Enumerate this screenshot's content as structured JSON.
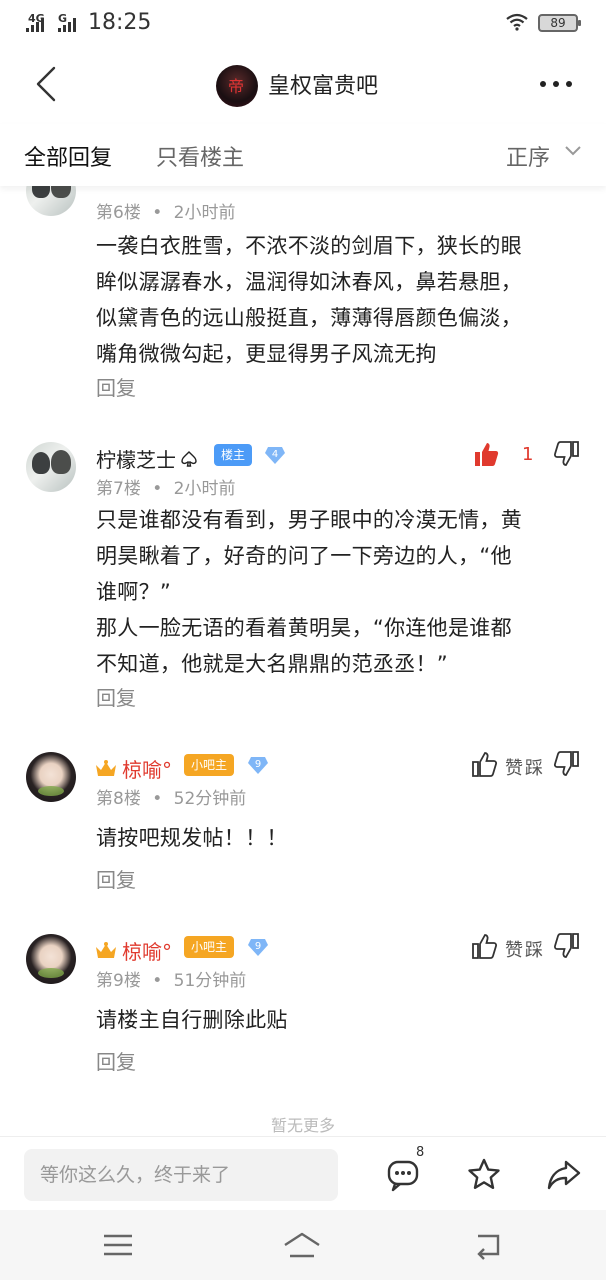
{
  "status_bar": {
    "signal1": "4G",
    "signal2": "G",
    "time": "18:25",
    "battery": "89"
  },
  "header": {
    "title": "皇权富贵吧"
  },
  "tabs": {
    "all": "全部回复",
    "owner_only": "只看楼主",
    "sort": "正序"
  },
  "posts": [
    {
      "floor": "第6楼",
      "time": "2小时前",
      "text_lines": [
        "一袭白衣胜雪，不浓不淡的剑眉下，狭长的眼",
        "眸似潺潺春水，温润得如沐春风，鼻若悬胆，",
        "似黛青色的远山般挺直，薄薄得唇颜色偏淡，",
        "嘴角微微勾起，更显得男子风流无拘"
      ],
      "reply": "回复"
    },
    {
      "username": "柠檬芝士",
      "badge": "楼主",
      "level": "4",
      "floor": "第7楼",
      "time": "2小时前",
      "likes": "1",
      "text_lines": [
        "只是谁都没有看到，男子眼中的冷漠无情，黄",
        "明昊瞅着了，好奇的问了一下旁边的人，“他",
        "谁啊？”",
        "那人一脸无语的看着黄明昊，“你连他是谁都",
        "不知道，他就是大名鼎鼎的范丞丞！”"
      ],
      "reply": "回复"
    },
    {
      "username": "椋喻°",
      "badge": "小吧主",
      "level": "9",
      "floor": "第8楼",
      "time": "52分钟前",
      "like_label": "赞",
      "dislike_label": "踩",
      "text_lines": [
        "请按吧规发帖！！！"
      ],
      "reply": "回复"
    },
    {
      "username": "椋喻°",
      "badge": "小吧主",
      "level": "9",
      "floor": "第9楼",
      "time": "51分钟前",
      "like_label": "赞",
      "dislike_label": "踩",
      "text_lines": [
        "请楼主自行删除此贴"
      ],
      "reply": "回复"
    }
  ],
  "footer": {
    "no_more": "暂无更多",
    "input_placeholder": "等你这么久，终于来了",
    "comment_count": "8"
  },
  "colors": {
    "accent_red": "#e03a2e",
    "badge_blue": "#4c9bf7",
    "badge_orange": "#f5a623"
  }
}
